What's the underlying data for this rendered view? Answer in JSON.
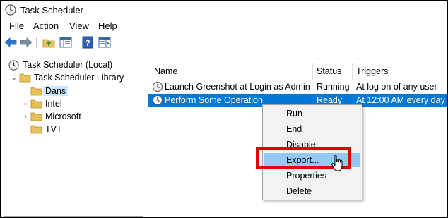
{
  "window": {
    "title": "Task Scheduler"
  },
  "menu": [
    "File",
    "Action",
    "View",
    "Help"
  ],
  "tree": {
    "root": "Task Scheduler (Local)",
    "library": "Task Scheduler Library",
    "folders": [
      "Dans",
      "Intel",
      "Microsoft",
      "TVT"
    ]
  },
  "columns": {
    "name": "Name",
    "status": "Status",
    "triggers": "Triggers"
  },
  "rows": [
    {
      "name": "Launch Greenshot at Login as Admin",
      "status": "Running",
      "trigger": "At log on of any user"
    },
    {
      "name": "Perform Some Operation",
      "status": "Ready",
      "trigger": "At 12:00 AM every day"
    }
  ],
  "context_menu": [
    "Run",
    "End",
    "Disable",
    "Export...",
    "Properties",
    "Delete"
  ],
  "colors": {
    "selection": "#0078d7",
    "hover": "#91c9f7",
    "highlight": "#e00000",
    "folder": "#e8c15a"
  },
  "icons": {
    "back": "back-arrow-icon",
    "forward": "forward-arrow-icon",
    "clock": "clock-icon",
    "folder": "folder-icon",
    "help": "help-icon",
    "cursor": "mouse-cursor-icon"
  }
}
